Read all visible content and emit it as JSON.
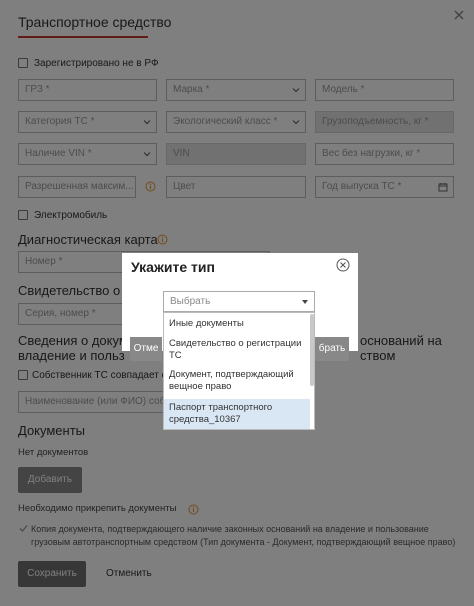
{
  "colors": {
    "accent": "#c0392b",
    "info_orange": "#e39a35",
    "disabled": "#e2e2e2",
    "overlay": "rgba(0,0,0,0.5)"
  },
  "form": {
    "title": "Транспортное средство",
    "registered_outside_label": "Зарегистрировано не в РФ",
    "fields": {
      "grz": "ГРЗ *",
      "marka": "Марка *",
      "model": "Модель *",
      "category": "Категория ТС *",
      "eco_class": "Экологический класс *",
      "capacity": "Грузоподъемность, кг *",
      "vin_presence": "Наличие VIN *",
      "vin": "VIN",
      "weight": "Вес без нагрузки, кг *",
      "max_mass": "Разрешенная максим...",
      "color": "Цвет",
      "year": "Год выпуска ТС *"
    },
    "electro_label": "Электромобиль",
    "diag_heading": "Диагностическая карта",
    "diag_number": "Номер *",
    "cert_heading": "Свидетельство о р",
    "cert_series": "Серия, номер *",
    "rights_heading_line1": "Сведения о докум",
    "rights_heading_right1": "оснований на",
    "rights_heading_line2": "владение и польз",
    "rights_heading_right2": "ством",
    "owner_match_label": "Собственник ТС совпадает с",
    "owner_name": "Наименование (или ФИО) собс",
    "documents_heading": "Документы",
    "no_documents": "Нет документов",
    "add_button": "Добавить",
    "need_attach": "Необходимо прикрепить документы",
    "requirement_text": "Копия документа, подтверждающего наличие законных оснований на владение и пользование грузовым автотранспортным средством (Тип документа - Документ, подтверждающий вещное право)",
    "save_button": "Сохранить",
    "cancel_button": "Отменить"
  },
  "modal": {
    "title": "Укажите тип",
    "select_placeholder": "Выбрать",
    "options": [
      "Иные документы",
      "Свидетельство о регистрации ТС",
      "Документ, подтверждающий вещное право",
      "Паспорт транспортного средства_10367"
    ],
    "highlighted_option_index": 3,
    "left_button": "Отме",
    "right_button": "брать"
  }
}
